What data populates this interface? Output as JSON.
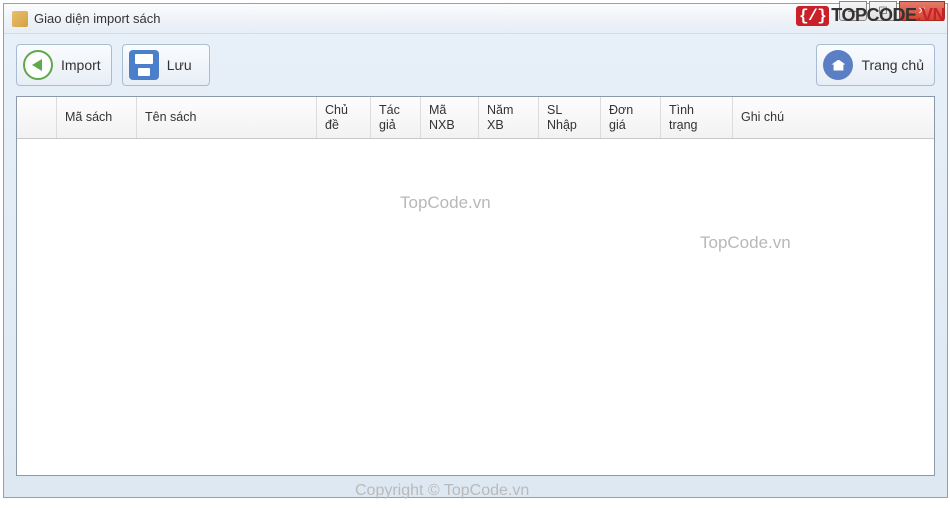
{
  "window": {
    "title": "Giao diện import sách"
  },
  "toolbar": {
    "import_label": "Import",
    "save_label": "Lưu",
    "home_label": "Trang chủ"
  },
  "grid": {
    "columns": {
      "ma_sach": "Mã sách",
      "ten_sach": "Tên sách",
      "chu_de": "Chủ đề",
      "tac_gia": "Tác giả",
      "ma_nxb": "Mã NXB",
      "nam_xb": "Năm XB",
      "sl_nhap": "SL Nhập",
      "don_gia": "Đơn giá",
      "tinh_trang": "Tình trạng",
      "ghi_chu": "Ghi chú"
    },
    "rows": []
  },
  "watermark": {
    "brand_code": "{/}",
    "brand_text": "TOPCODE",
    "brand_tld": ".VN",
    "body1": "TopCode.vn",
    "body2": "TopCode.vn",
    "footer": "Copyright © TopCode.vn"
  }
}
